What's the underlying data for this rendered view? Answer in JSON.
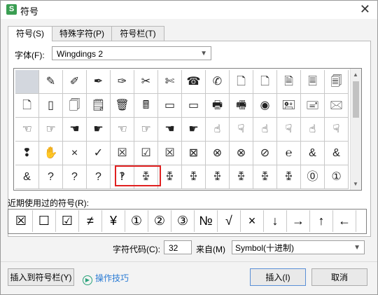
{
  "window": {
    "title": "符号",
    "app_icon_letter": "S",
    "close_glyph": "✕"
  },
  "tabs": [
    {
      "label": "符号(S)"
    },
    {
      "label": "特殊字符(P)"
    },
    {
      "label": "符号栏(T)"
    }
  ],
  "font": {
    "label": "字体(F):",
    "value": "Wingdings 2"
  },
  "symbols": [
    "",
    "✎",
    "✐",
    "✒",
    "✑",
    "✂",
    "✄",
    "☎",
    "✆",
    "🗋",
    "🗋",
    "🗎",
    "🗏",
    "🗐",
    "🗋",
    "▯",
    "🗍",
    "🗒",
    "🗑",
    "🖩",
    "▭",
    "▭",
    "🖶",
    "🖷",
    "◉",
    "🖭",
    "🖃",
    "🖂",
    "☜",
    "☞",
    "☚",
    "☛",
    "☜",
    "☞",
    "☚",
    "☛",
    "☝",
    "☟",
    "☝",
    "☟",
    "☝",
    "☟",
    "❢",
    "✋",
    "×",
    "✓",
    "☒",
    "☑",
    "☒",
    "⊠",
    "⊗",
    "⊗",
    "⊘",
    "℮",
    "&",
    "&",
    "&",
    "?",
    "?",
    "?",
    "‽",
    "ꔁ",
    "ꔁ",
    "ꔁ",
    "ꔁ",
    "ꔁ",
    "ꔁ",
    "ꔁ",
    "⓪",
    "①"
  ],
  "recent": {
    "label": "近期使用过的符号(R):",
    "items": [
      "☒",
      "☐",
      "☑",
      "≠",
      "¥",
      "①",
      "②",
      "③",
      "№",
      "√",
      "×",
      "↓",
      "→",
      "↑",
      "←"
    ]
  },
  "char_code": {
    "label": "字符代码(C):",
    "value": "32"
  },
  "from": {
    "label": "来自(M)",
    "value": "Symbol(十进制)"
  },
  "buttons": {
    "insert_to_bar": "插入到符号栏(Y)",
    "tips": "操作技巧",
    "insert": "插入(I)",
    "cancel": "取消"
  }
}
